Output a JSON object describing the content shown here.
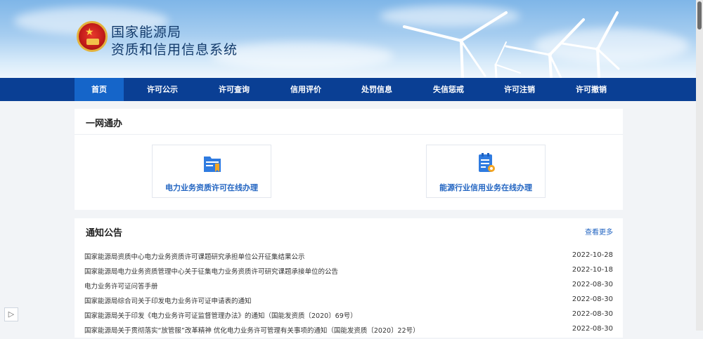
{
  "header": {
    "org_name": "国家能源局",
    "system_name": "资质和信用信息系统"
  },
  "nav": {
    "items": [
      {
        "label": "首页",
        "active": true
      },
      {
        "label": "许可公示"
      },
      {
        "label": "许可查询"
      },
      {
        "label": "信用评价"
      },
      {
        "label": "处罚信息"
      },
      {
        "label": "失信惩戒"
      },
      {
        "label": "许可注销"
      },
      {
        "label": "许可撤销"
      }
    ]
  },
  "services": {
    "title": "一网通办",
    "cards": [
      {
        "label": "电力业务资质许可在线办理",
        "icon": "folder-icon"
      },
      {
        "label": "能源行业信用业务在线办理",
        "icon": "document-gear-icon"
      }
    ]
  },
  "notices": {
    "title": "通知公告",
    "more_label": "查看更多",
    "items": [
      {
        "title": "国家能源局资质中心电力业务资质许可课题研究承担单位公开征集结果公示",
        "date": "2022-10-28"
      },
      {
        "title": "国家能源局电力业务资质管理中心关于征集电力业务资质许可研究课题承接单位的公告",
        "date": "2022-10-18"
      },
      {
        "title": "电力业务许可证问答手册",
        "date": "2022-08-30"
      },
      {
        "title": "国家能源局综合司关于印发电力业务许可证申请表的通知",
        "date": "2022-08-30"
      },
      {
        "title": "国家能源局关于印发《电力业务许可证监督管理办法》的通知（国能发资质〔2020〕69号）",
        "date": "2022-08-30"
      },
      {
        "title": "国家能源局关于贯彻落实“放管服”改革精神 优化电力业务许可管理有关事项的通知（国能发资质〔2020〕22号）",
        "date": "2022-08-30"
      }
    ]
  },
  "colors": {
    "nav_bg": "#0a3f94",
    "nav_active": "#1565c9",
    "link": "#2466c2"
  }
}
